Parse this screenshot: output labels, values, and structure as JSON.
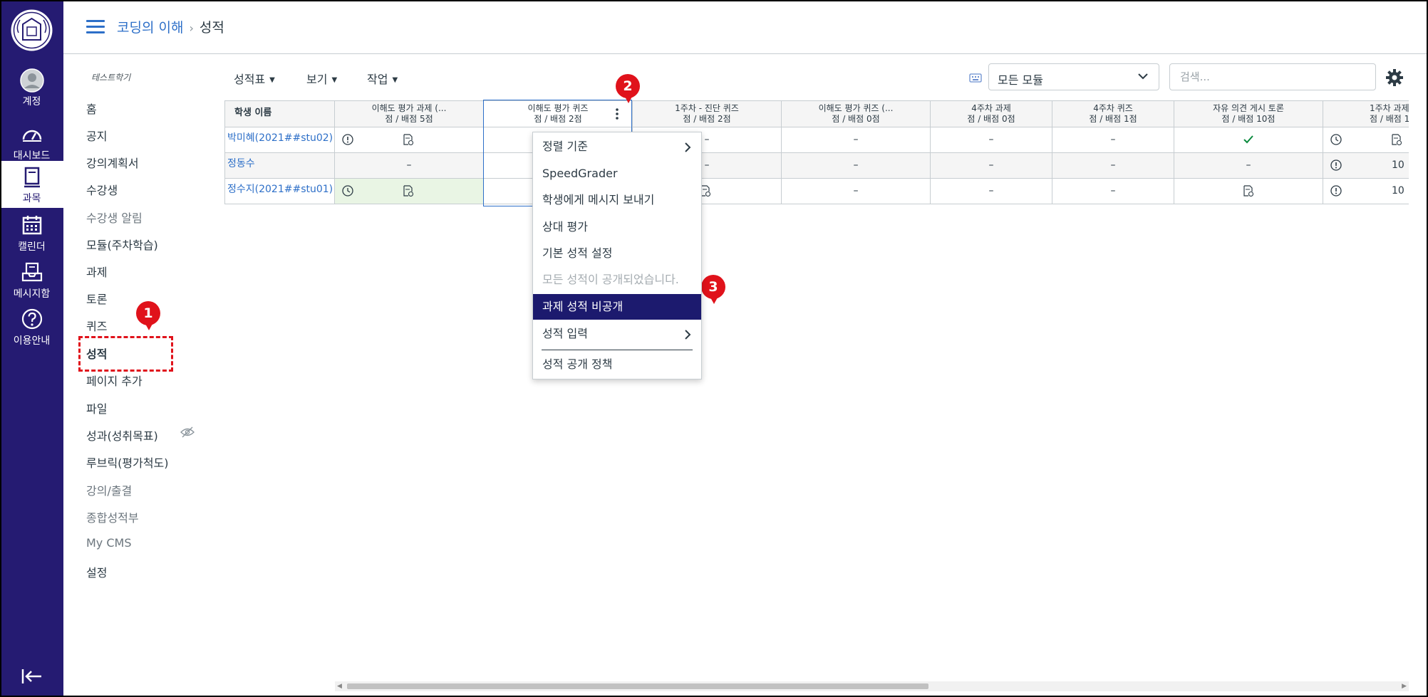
{
  "global_nav": {
    "items": [
      {
        "label": "계정",
        "icon": "user-avatar-icon"
      },
      {
        "label": "대시보드",
        "icon": "dashboard-icon"
      },
      {
        "label": "과목",
        "icon": "courses-icon"
      },
      {
        "label": "캘린더",
        "icon": "calendar-icon"
      },
      {
        "label": "메시지함",
        "icon": "inbox-icon"
      },
      {
        "label": "이용안내",
        "icon": "help-icon"
      }
    ],
    "active": "과목",
    "colors": {
      "nav_bg": "#251b72",
      "link": "#2d6fc8",
      "annotation": "#e0121b",
      "menu_selected": "#1c1a6e"
    }
  },
  "header": {
    "breadcrumb_course": "코딩의 이해",
    "breadcrumb_separator": "›",
    "breadcrumb_current": "성적"
  },
  "course_nav": {
    "term": "테스트학기",
    "items": [
      "홈",
      "공지",
      "강의계획서",
      "수강생",
      "수강생 알림",
      "모듈(주차학습)",
      "과제",
      "토론",
      "퀴즈",
      "성적",
      "페이지 추가",
      "파일",
      "성과(성취목표)",
      "루브릭(평가척도)",
      "강의/출결",
      "종합성적부",
      "My CMS",
      "설정"
    ]
  },
  "toolbar": {
    "gradebook": "성적표",
    "view": "보기",
    "actions": "작업",
    "module_filter": "모든 모듈",
    "search_placeholder": "검색..."
  },
  "grid": {
    "name_header": "학생 이름",
    "columns": [
      {
        "title": "이해도 평가 과제 (...",
        "points": "점 / 배점 5점"
      },
      {
        "title": "이해도 평가 퀴즈",
        "points": "점 / 배점 2점"
      },
      {
        "title": "1주차 - 진단 퀴즈",
        "points": "점 / 배점 2점"
      },
      {
        "title": "이해도 평가 퀴즈 (...",
        "points": "점 / 배점 0점"
      },
      {
        "title": "4주차 과제",
        "points": "점 / 배점 0점"
      },
      {
        "title": "4주차 퀴즈",
        "points": "점 / 배점 1점"
      },
      {
        "title": "자유 의견 게시 토론",
        "points": "점 / 배점 10점"
      },
      {
        "title": "1주차 과제 (",
        "points": "점 / 배점 1"
      }
    ],
    "rows": [
      {
        "name": "박미혜(2021##stu02)",
        "c3": "–",
        "c4": "–",
        "c5": "–",
        "c6": "–"
      },
      {
        "name": "정동수",
        "c1": "–",
        "c3": "–",
        "c4": "–",
        "c5": "–",
        "c6": "–",
        "c7": "–",
        "c8": "10"
      },
      {
        "name": "정수지(2021##stu01)",
        "c4": "–",
        "c5": "–",
        "c6": "–",
        "c8": "10"
      }
    ]
  },
  "context_menu": {
    "items": [
      "정렬 기준",
      "SpeedGrader",
      "학생에게 메시지 보내기",
      "상대 평가",
      "기본 성적 설정",
      "모든 성적이 공개되었습니다.",
      "과제 성적 비공개",
      "성적 입력",
      "성적 공개 정책"
    ]
  },
  "annotations": [
    "1",
    "2",
    "3"
  ]
}
